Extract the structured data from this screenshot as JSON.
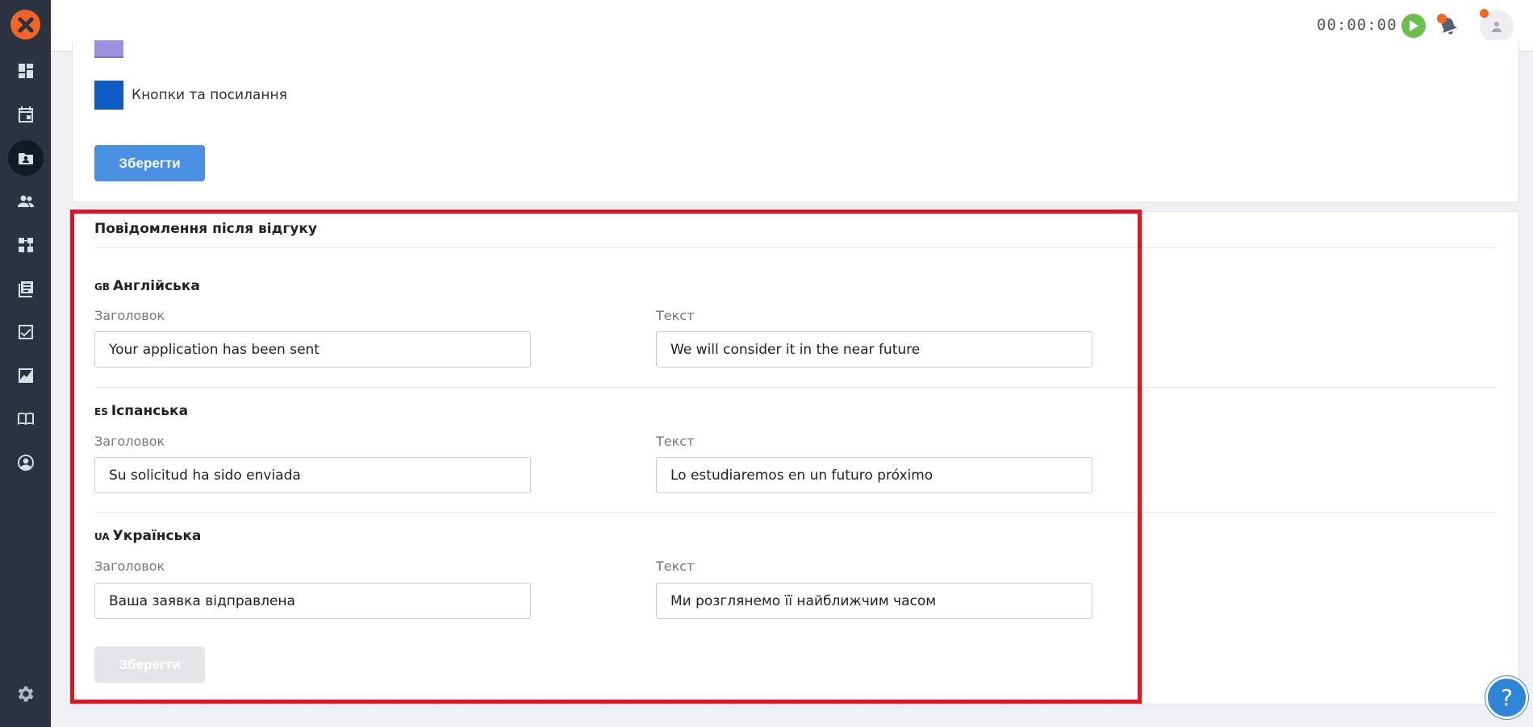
{
  "header": {
    "timer": "00:00:00"
  },
  "settings_card": {
    "swatch_label": "Кнопки та посилання",
    "save_label": "Зберегти"
  },
  "feedback_message": {
    "title": "Повідомлення після відгуку",
    "languages": [
      {
        "code": "GB",
        "name": "Англійська",
        "title_label": "Заголовок",
        "title_value": "Your application has been sent",
        "text_label": "Текст",
        "text_value": "We will consider it in the near future"
      },
      {
        "code": "ES",
        "name": "Іспанська",
        "title_label": "Заголовок",
        "title_value": "Su solicitud ha sido enviada",
        "text_label": "Текст",
        "text_value": "Lo estudiaremos en un futuro próximo"
      },
      {
        "code": "UA",
        "name": "Українська",
        "title_label": "Заголовок",
        "title_value": "Ваша заявка відправлена",
        "text_label": "Текст",
        "text_value": "Ми розглянемо її найближчим часом"
      }
    ],
    "save_label": "Зберегти"
  },
  "help": {
    "label": "?"
  },
  "colors": {
    "sidebar_bg": "#2b3342",
    "brand_orange": "#f26522",
    "primary_blue": "#4a90e2",
    "swatch_blue": "#0d5bc6",
    "swatch_purple": "#9b8fe0",
    "highlight_red": "#e8101a"
  },
  "sidebar": {
    "items": [
      {
        "icon": "dashboard-icon"
      },
      {
        "icon": "calendar-icon"
      },
      {
        "icon": "vacancies-icon",
        "active": true
      },
      {
        "icon": "people-icon"
      },
      {
        "icon": "workflow-icon"
      },
      {
        "icon": "library-icon"
      },
      {
        "icon": "tasks-icon"
      },
      {
        "icon": "reports-icon"
      },
      {
        "icon": "book-icon"
      },
      {
        "icon": "account-icon"
      }
    ]
  }
}
